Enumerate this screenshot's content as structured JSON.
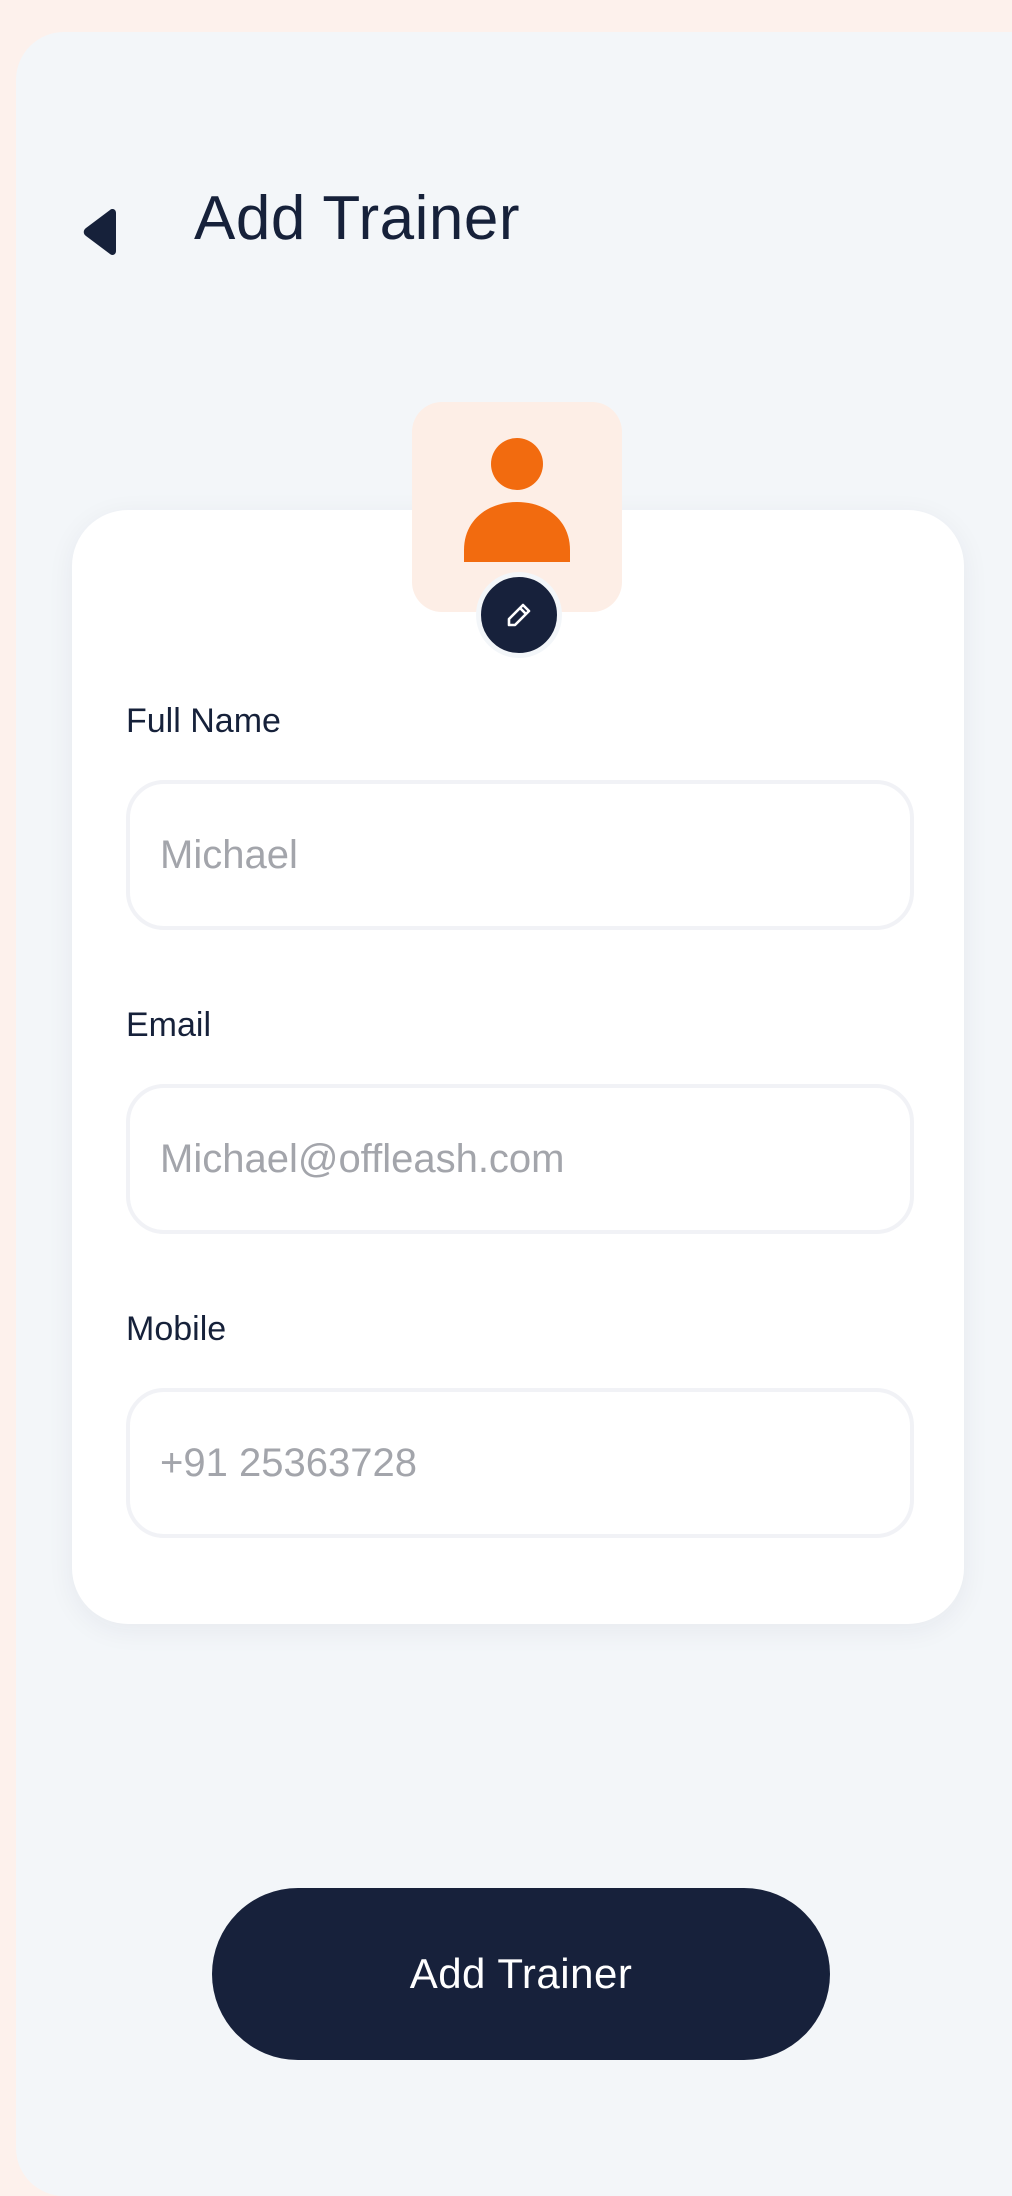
{
  "header": {
    "title": "Add Trainer",
    "back_icon": "back-arrow-icon"
  },
  "avatar": {
    "icon": "person-icon",
    "edit_icon": "pencil-icon",
    "accent_color": "#F26B0F"
  },
  "form": {
    "full_name": {
      "label": "Full Name",
      "placeholder": "Michael",
      "value": ""
    },
    "email": {
      "label": "Email",
      "placeholder": "Michael@offleash.com",
      "value": ""
    },
    "mobile": {
      "label": "Mobile",
      "placeholder": "+91 25363728",
      "value": ""
    }
  },
  "submit_label": "Add Trainer",
  "colors": {
    "navy": "#17213B",
    "page_background": "#F3F6F9",
    "outer_background": "#FDF1EC",
    "avatar_tile": "#FDEEE6"
  }
}
